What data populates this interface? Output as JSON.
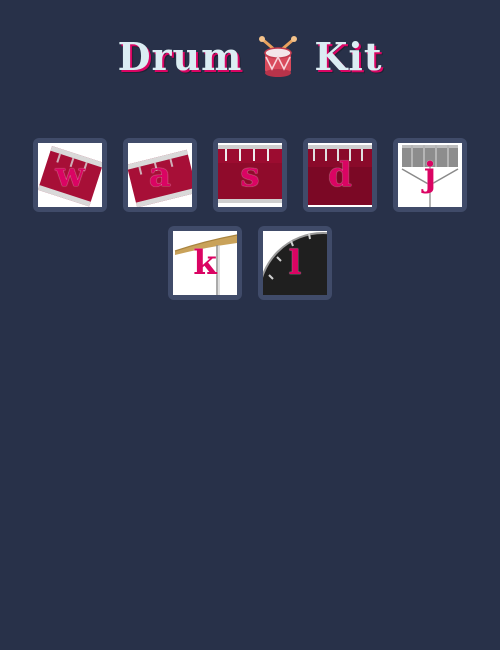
{
  "title": {
    "left": "Drum",
    "right": "Kit",
    "icon": "drum-icon"
  },
  "keys": [
    {
      "letter": "w",
      "instrument": "tom-icon"
    },
    {
      "letter": "a",
      "instrument": "tom-icon"
    },
    {
      "letter": "s",
      "instrument": "snare-icon"
    },
    {
      "letter": "d",
      "instrument": "snare-icon"
    },
    {
      "letter": "j",
      "instrument": "hihat-icon"
    },
    {
      "letter": "k",
      "instrument": "crash-cymbal-icon"
    },
    {
      "letter": "l",
      "instrument": "kick-drum-icon"
    }
  ],
  "colors": {
    "background": "#283149",
    "key_frame": "#404B69",
    "letter": "#da0463",
    "title": "#DBEDF3"
  }
}
